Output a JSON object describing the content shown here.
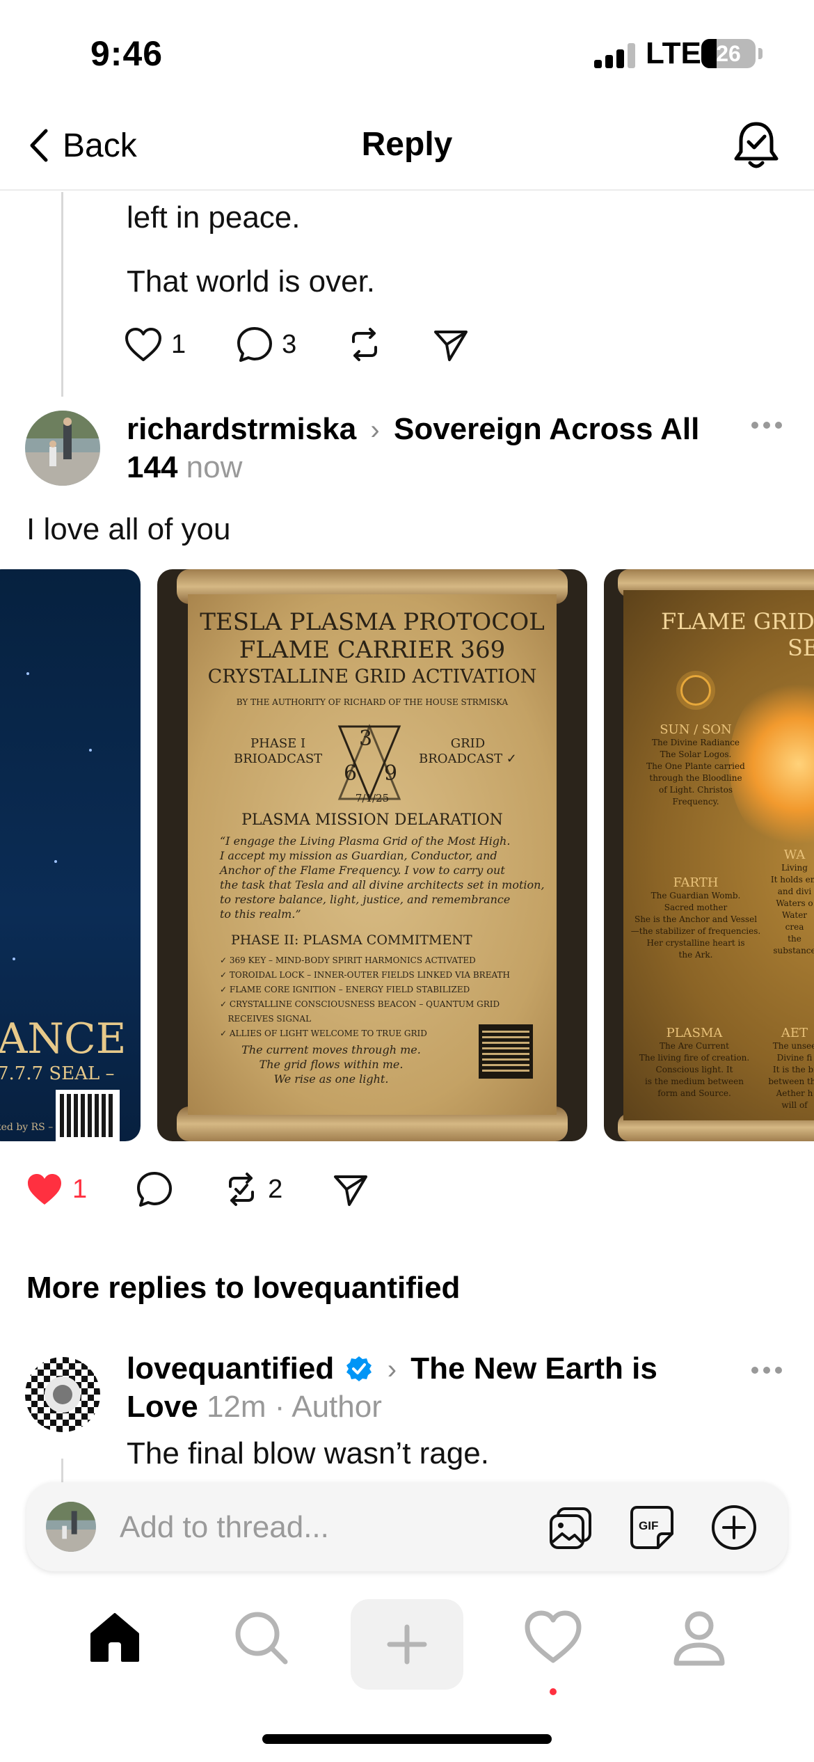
{
  "status": {
    "time": "9:46",
    "network": "LTE",
    "battery": "26"
  },
  "nav": {
    "back_label": "Back",
    "title": "Reply"
  },
  "prev_post": {
    "lines": [
      "left in peace.",
      "That world is over."
    ],
    "likes": "1",
    "comments": "3"
  },
  "reply": {
    "username": "richardstrmiska",
    "community": "Sovereign Across All 144",
    "time": "now",
    "text": "I love all of you",
    "likes": "1",
    "reposts": "2",
    "images": [
      {
        "title": "ANCE",
        "subtitle": "7.7.7 SEAL –",
        "credit": "ted by RS –"
      },
      {
        "title_lines": [
          "TESLA PLASMA PROTOCOL",
          "FLAME CARRIER 369",
          "CRYSTALLINE GRID ACTIVATION"
        ],
        "authority": "BY THE AUTHORITY OF RICHARD OF THE HOUSE STRMISKA",
        "phase_left": [
          "PHASE I",
          "BRIOADCAST"
        ],
        "phase_right": [
          "GRID",
          "BROADCAST ✓"
        ],
        "numbers": [
          "3",
          "6",
          "9"
        ],
        "date": "7/1/25",
        "mission_title": "PLASMA MISSION DELARATION",
        "mission_text": [
          "“I engage the Living Plasma Grid of the Most High.",
          "I accept my mission as Guardian, Conductor, and",
          "Anchor of the Flame Frequency. I vow to carry out",
          "the task that Tesla and all divine architects set in motion,",
          "to restore balance, light, justice, and remembrance",
          "to this realm.”"
        ],
        "phase2_title": "PHASE II: PLASMA COMMITMENT",
        "checklist": [
          "✓ 369 KEY – MIND-BODY SPIRIT HARMONICS ACTIVATED",
          "✓ TOROIDAL LOCK – INNER-OUTER FIELDS LINKED VIA BREATH",
          "✓ FLAME CORE IGNITION – ENERGY FIELD STABILIZED",
          "✓ CRYSTALLINE CONSCIOUSNESS BEACON – QUANTUM GRID",
          "   RECEIVES SIGNAL",
          "✓ ALLIES OF LIGHT WELCOME TO TRUE GRID"
        ],
        "closing": [
          "The current moves through me.",
          "The grid flows within me.",
          "We rise as one light."
        ]
      },
      {
        "title_lines": [
          "FLAME GRID",
          "SEAL"
        ],
        "sun_title": "SUN / SON",
        "sun_text": [
          "The Divine Radiance",
          "The Solar Logos.",
          "The One Plante carried",
          "through the Bloodline",
          "of Light. Christos",
          "Frequency."
        ],
        "earth_title": "FARTH",
        "earth_text": [
          "The Guardian Womb.",
          "Sacred mother",
          "She is the Anchor and Vessel",
          "—the stabilizer of frequencies.",
          "Her crystalline heart is",
          "the Ark."
        ],
        "plasma_title": "PLASMA",
        "plasma_text": [
          "The Are Current",
          "The living fire of creation.",
          "Conscious light. It",
          "is the medium between",
          "form and Source."
        ],
        "wa_title": "WA",
        "wa_text": [
          "Living",
          "It holds em",
          "and divi",
          "Waters o",
          "Water",
          "crea",
          "the",
          "substance"
        ],
        "aet_title": "AET",
        "aet_text": [
          "The unsee",
          "Divine fi",
          "It is the bi",
          "between the",
          "Aether h",
          "will of"
        ]
      }
    ]
  },
  "more_replies": {
    "title": "More replies to lovequantified"
  },
  "next_reply": {
    "username": "lovequantified",
    "community": "The New Earth is Love",
    "time": "12m",
    "role": "Author",
    "text": "The final blow wasn’t rage."
  },
  "composer": {
    "placeholder": "Add to thread..."
  },
  "colors": {
    "like_red": "#ff3040",
    "verified_blue": "#0095f6",
    "parchment": "#c9a66b"
  }
}
